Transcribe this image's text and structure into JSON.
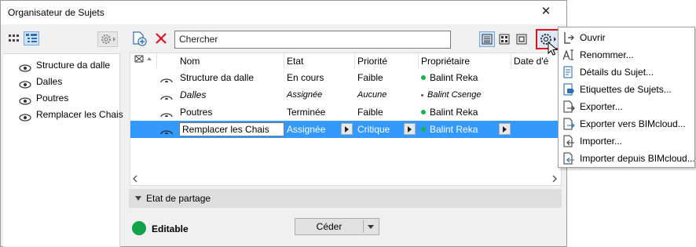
{
  "window": {
    "title": "Organisateur de Sujets",
    "close_label": "✕"
  },
  "left_panel": {
    "items": [
      {
        "label": "Structure da dalle"
      },
      {
        "label": "Dalles"
      },
      {
        "label": "Poutres"
      },
      {
        "label": "Remplacer les Chais"
      }
    ]
  },
  "toolbar": {
    "search_placeholder": "Chercher"
  },
  "table": {
    "columns": [
      "Nom",
      "Etat",
      "Priorité",
      "Propriétaire",
      "Date d'é"
    ],
    "rows": [
      {
        "name": "Structure da dalle",
        "status": "En cours",
        "priority": "Faible",
        "owner": "Balint Reka",
        "italic": false,
        "selected": false
      },
      {
        "name": "Dalles",
        "status": "Assignée",
        "priority": "Aucune",
        "owner": "Balint Csenge",
        "italic": true,
        "selected": false
      },
      {
        "name": "Poutres",
        "status": "Terminée",
        "priority": "Faible",
        "owner": "Balint Reka",
        "italic": false,
        "selected": false
      },
      {
        "name": "Remplacer les Chais",
        "status": "Assignée",
        "priority": "Critique",
        "owner": "Balint Reka",
        "italic": false,
        "selected": true
      }
    ]
  },
  "sharing": {
    "header": "Etat de partage",
    "status": "Editable",
    "status_color": "#12a24a",
    "button_label": "Céder"
  },
  "context_menu": {
    "items": [
      {
        "label": "Ouvrir",
        "icon": "open-icon"
      },
      {
        "label": "Renommer...",
        "icon": "rename-icon"
      },
      {
        "label": "Détails du Sujet...",
        "icon": "details-icon"
      },
      {
        "label": "Etiquettes de Sujets...",
        "icon": "labels-icon"
      },
      {
        "label": "Exporter...",
        "icon": "export-icon"
      },
      {
        "label": "Exporter vers BIMcloud...",
        "icon": "export-cloud-icon"
      },
      {
        "label": "Importer...",
        "icon": "import-icon"
      },
      {
        "label": "Importer depuis BIMcloud...",
        "icon": "import-cloud-icon"
      }
    ]
  },
  "colors": {
    "selection": "#3399ff",
    "owner_dot": "#18b24d",
    "highlight_border": "#e0111b",
    "delete_icon": "#e81123"
  }
}
